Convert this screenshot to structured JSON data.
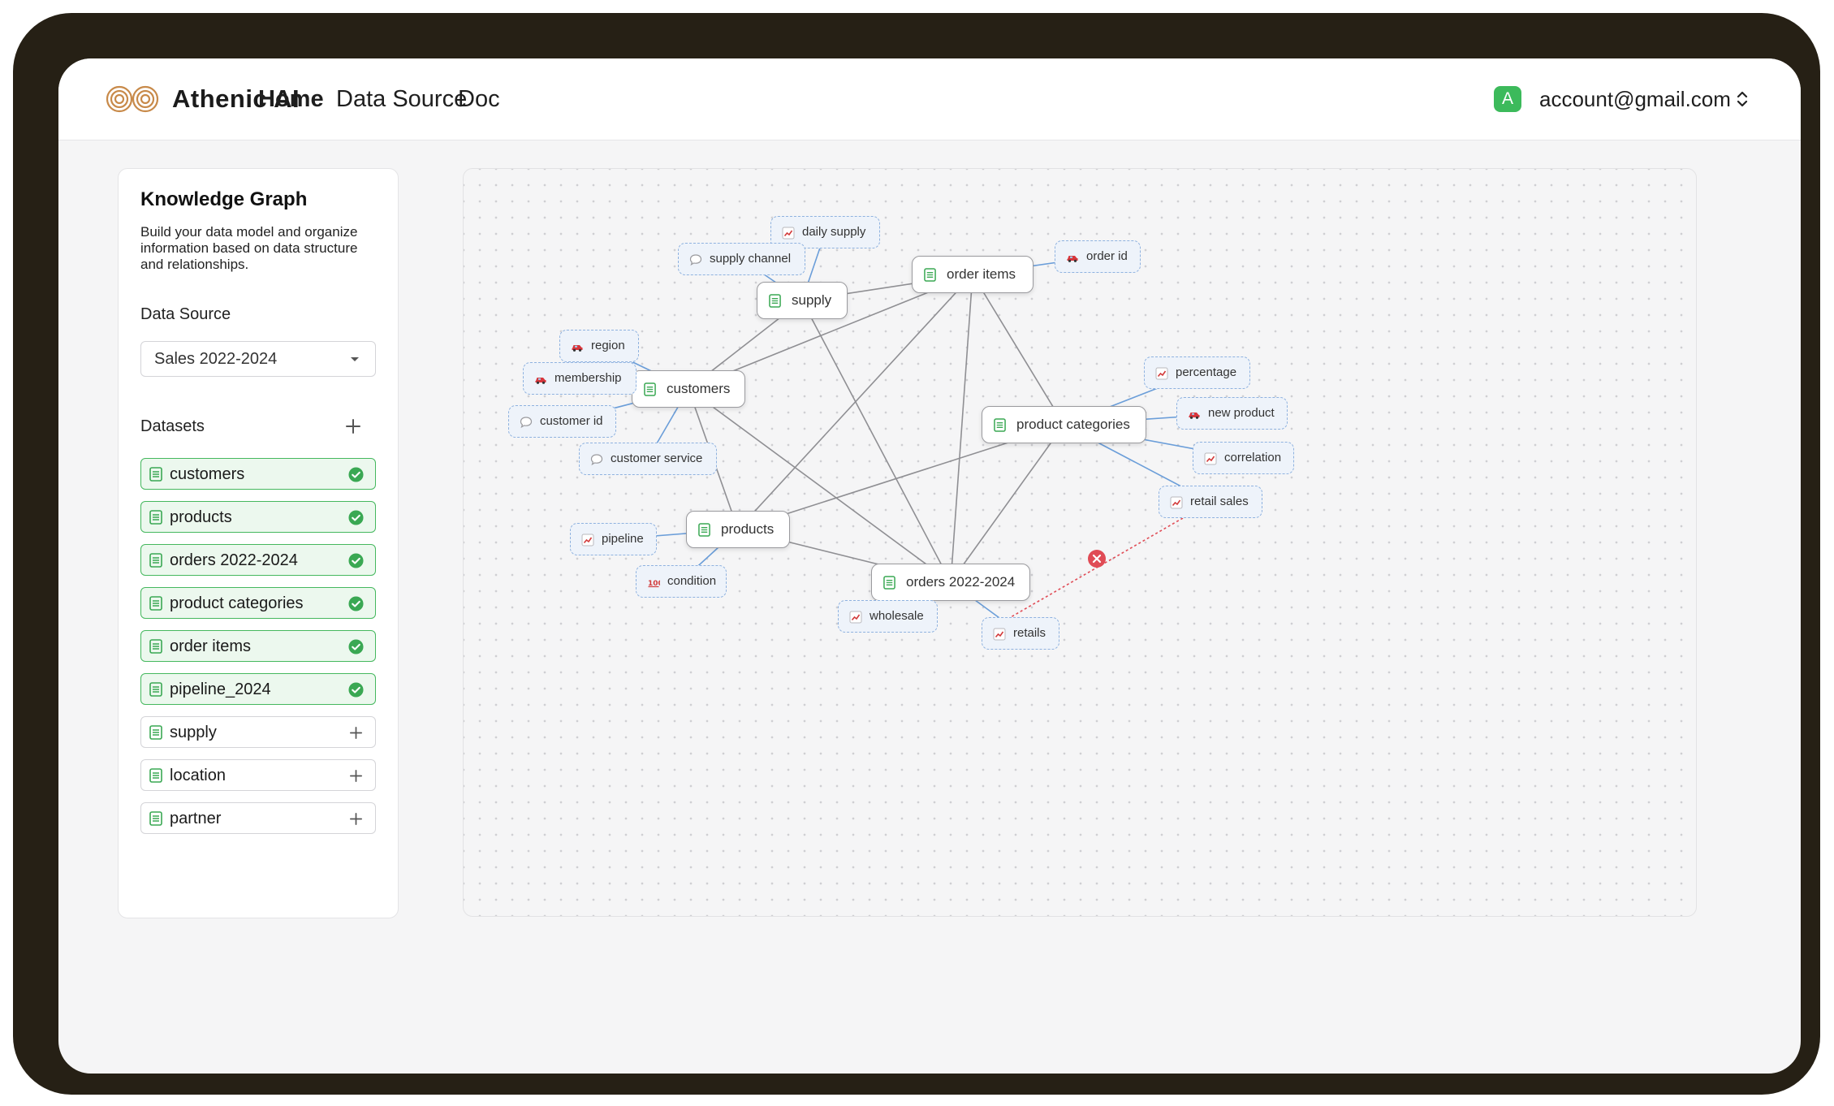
{
  "header": {
    "brand": "Athenic AI",
    "nav": [
      "Home",
      "Data Source",
      "Doc"
    ],
    "active_nav": "Home",
    "account_initial": "A",
    "account_email": "account@gmail.com",
    "avatar_color": "#3cba5b"
  },
  "panel": {
    "title": "Knowledge Graph",
    "description": "Build your data model and organize information based on data structure and relationships.",
    "data_source_label": "Data Source",
    "data_source_value": "Sales 2022-2024",
    "datasets_label": "Datasets",
    "datasets": [
      {
        "name": "customers",
        "selected": true
      },
      {
        "name": "products",
        "selected": true
      },
      {
        "name": "orders 2022-2024",
        "selected": true
      },
      {
        "name": "product categories",
        "selected": true
      },
      {
        "name": "order items",
        "selected": true
      },
      {
        "name": "pipeline_2024",
        "selected": true
      },
      {
        "name": "supply",
        "selected": false
      },
      {
        "name": "location",
        "selected": false
      },
      {
        "name": "partner",
        "selected": false
      }
    ]
  },
  "graph": {
    "tables": [
      "order items",
      "supply",
      "customers",
      "product categories",
      "products",
      "orders 2022-2024"
    ],
    "attributes": [
      {
        "label": "daily supply",
        "icon": "chart-icon",
        "table": "supply"
      },
      {
        "label": "supply channel",
        "icon": "chat-icon",
        "table": "supply"
      },
      {
        "label": "order id",
        "icon": "car-icon",
        "table": "order items"
      },
      {
        "label": "region",
        "icon": "car-icon",
        "table": "customers"
      },
      {
        "label": "membership",
        "icon": "car-icon",
        "table": "customers"
      },
      {
        "label": "customer id",
        "icon": "chat-icon",
        "table": "customers"
      },
      {
        "label": "customer service",
        "icon": "chat-icon",
        "table": "customers"
      },
      {
        "label": "percentage",
        "icon": "chart-icon",
        "table": "product categories"
      },
      {
        "label": "new product",
        "icon": "car-icon",
        "table": "product categories"
      },
      {
        "label": "correlation",
        "icon": "chart-icon",
        "table": "product categories"
      },
      {
        "label": "retail sales",
        "icon": "chart-icon",
        "table": "product categories"
      },
      {
        "label": "pipeline",
        "icon": "chart-icon",
        "table": "products"
      },
      {
        "label": "condition",
        "icon": "hundred-icon",
        "table": "products"
      },
      {
        "label": "wholesale",
        "icon": "chart-icon",
        "table": "orders 2022-2024"
      },
      {
        "label": "retails",
        "icon": "chart-icon",
        "table": "orders 2022-2024"
      }
    ],
    "colors": {
      "relation": "#8f8f93",
      "attribute_link": "#6b9ed9",
      "pending_link": "#e04b55",
      "selected": "#45b85e"
    }
  }
}
